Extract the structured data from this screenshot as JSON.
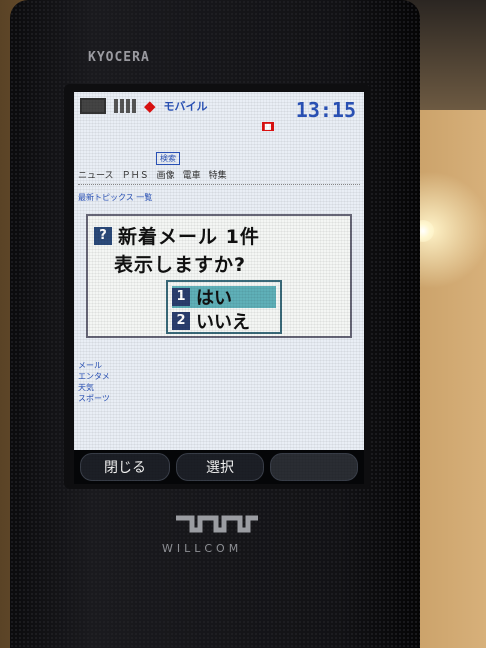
{
  "device": {
    "brand": "KYOCERA",
    "carrier": "WILLCOM"
  },
  "status_bar": {
    "clock": "13:15",
    "carrier_text": "モバイル"
  },
  "browser": {
    "search_label": "検索",
    "menu_items": [
      "ニュース",
      "ＰＨＳ",
      "画像",
      "電車",
      "特集"
    ],
    "link_row": "最新トピックス 一覧"
  },
  "dialog": {
    "icon_label": "?",
    "title": "新着メール 1件",
    "question": "表示しますか?",
    "options": [
      {
        "number": "1",
        "label": "はい",
        "selected": true
      },
      {
        "number": "2",
        "label": "いいえ",
        "selected": false
      }
    ]
  },
  "list_fragments": [
    "メール",
    "エンタメ",
    "天気",
    "スポーツ"
  ],
  "softkeys": {
    "left": "閉じる",
    "center": "選択",
    "right": ""
  },
  "colors": {
    "screen_bg": "#e9eef5",
    "selected_option": "#5fb0b8",
    "status_blue": "#2a52b8"
  }
}
